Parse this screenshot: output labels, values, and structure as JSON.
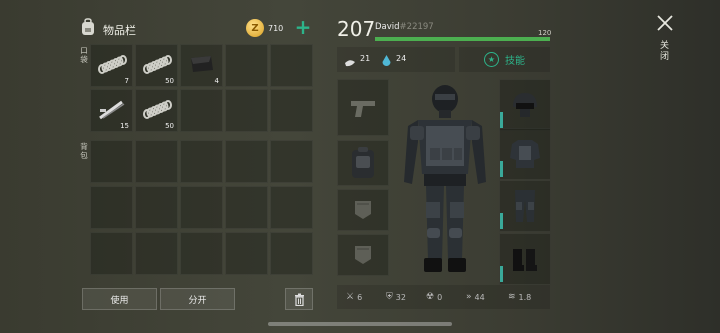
{
  "inventory": {
    "title": "物品栏",
    "coins": "710",
    "pocket_label": "口袋",
    "backpack_label": "背包",
    "pocket_items": [
      {
        "icon": "rope-icon",
        "count": "7"
      },
      {
        "icon": "rope-icon",
        "count": "50"
      },
      {
        "icon": "cloth-icon",
        "count": "4"
      },
      {
        "icon": "",
        "count": ""
      },
      {
        "icon": "",
        "count": ""
      },
      {
        "icon": "tools-icon",
        "count": "15"
      },
      {
        "icon": "rope-icon",
        "count": "50"
      },
      {
        "icon": "",
        "count": ""
      },
      {
        "icon": "",
        "count": ""
      },
      {
        "icon": "",
        "count": ""
      }
    ],
    "use_button": "使用",
    "split_button": "分开"
  },
  "character": {
    "level": "207",
    "name": "David",
    "id": "#22197",
    "xp_value": "120",
    "xp_fraction": 1.0,
    "hunger": "21",
    "water": "24",
    "skills_button": "技能"
  },
  "stats": [
    {
      "icon": "attack-icon",
      "value": "6"
    },
    {
      "icon": "armor-icon",
      "value": "32"
    },
    {
      "icon": "radiation-icon",
      "value": "0"
    },
    {
      "icon": "speed-icon",
      "value": "44"
    },
    {
      "icon": "stealth-icon",
      "value": "1.8"
    }
  ],
  "close": {
    "label": "关闭"
  },
  "colors": {
    "xp_bar": "#4caf50",
    "accent": "#2db38a",
    "durability": "#3aa99a"
  }
}
